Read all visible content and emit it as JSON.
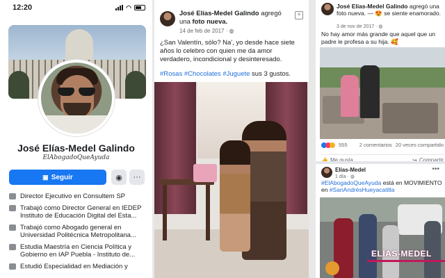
{
  "status_bar": {
    "time": "12:20"
  },
  "profile": {
    "name": "José Elías-Medel Galindo",
    "tagline": "ElAbogadoQueAyuda",
    "follow_label": "Seguir",
    "messenger_icon": "messenger-icon",
    "more_label": "···",
    "about": [
      {
        "icon": "briefcase-icon",
        "text": "Director Ejecutivo en Consultem SP",
        "line2": ""
      },
      {
        "icon": "briefcase-icon",
        "text": "Trabajó como Director General en IEDEP",
        "line2": "Instituto de Educación Digital del Esta..."
      },
      {
        "icon": "briefcase-icon",
        "text": "Trabajó como Abogado general en",
        "line2": "Universidad Politécnica Metropolitana..."
      },
      {
        "icon": "graduation-cap-icon",
        "text": "Estudia Maestría en Ciencia Política y",
        "line2": "Gobierno en IAP Puebla - Instituto de..."
      },
      {
        "icon": "graduation-cap-icon",
        "text": "Estudió Especialidad en Mediación y",
        "line2": ""
      }
    ]
  },
  "post1": {
    "author": "José Elías-Medel Galindo",
    "action_a": "agregó una",
    "action_b": "foto nueva.",
    "date": "14 de feb de 2017 · ",
    "text": "¿San Valentín, sólo? Na', yo desde hace siete años lo celebro con quien me da amor verdadero, incondicional y desinteresado.",
    "tags": [
      "#Rosas",
      "#Chocolates",
      "#Juguete"
    ],
    "tags_suffix": " sus 3 gustos."
  },
  "post2": {
    "author": "José Elías-Medel Galindo",
    "action": "agregó una foto nueva.",
    "feeling": "— 😍 se siente enamorado.",
    "date": "3 de nov de 2017 · ",
    "text": "No hay amor más grande que aquel que un padre le profesa a su hija. 🥰",
    "reactions_count": "555",
    "comments": "2 comentarios",
    "shares": "20 veces compartido",
    "like_label": "Me gusta",
    "share_label": "Compartir",
    "colors": {
      "like": "#1877f2",
      "love": "#f33e58",
      "haha": "#f7b125"
    }
  },
  "post3": {
    "author": "Elías-Medel",
    "date": "1 día · ",
    "tag1": "#ElAbogadoQueAyuda",
    "middle": " está en MOVIMIENTO en ",
    "tag2": "#SanAndrésHueyacatitla",
    "brand": "ELÍAS-MEDEL"
  }
}
